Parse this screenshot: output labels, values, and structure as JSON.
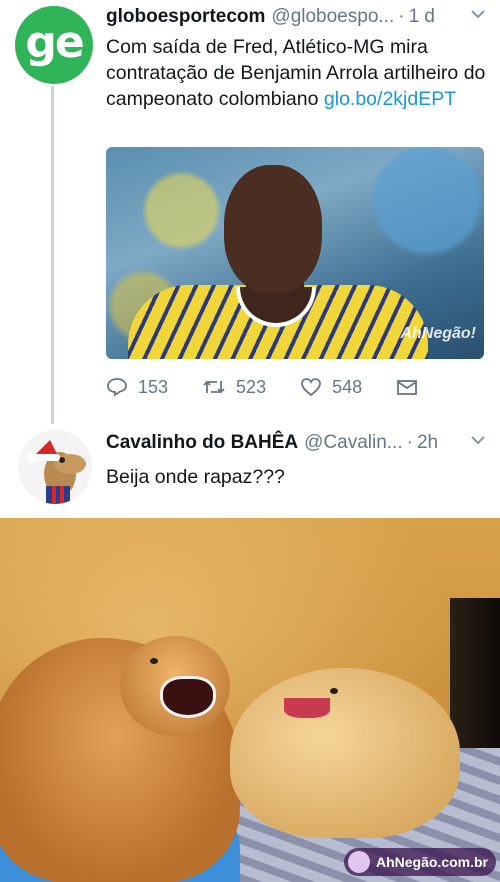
{
  "tweets": [
    {
      "avatar_text": "ge",
      "display_name": "globoesportecom",
      "handle": "@globoespo...",
      "separator": "·",
      "time": "1 d",
      "text": "Com saída de Fred, Atlético-MG mira contratação de Benjamin Arrola artilheiro do campeonato colombiano ",
      "link": "glo.bo/2kjdEPT",
      "media_watermark": "AhNegão!",
      "actions": {
        "replies": "153",
        "retweets": "523",
        "likes": "548"
      }
    },
    {
      "display_name": "Cavalinho do BAHÊA",
      "handle": "@Cavalin...",
      "separator": "·",
      "time": "2h",
      "text": "Beija onde rapaz???"
    }
  ],
  "footer_watermark": "AhNegão.com.br",
  "colors": {
    "link": "#1b95e0",
    "avatar_green": "#2fb45a",
    "thread_line": "#c4d3df",
    "muted": "#657786"
  }
}
